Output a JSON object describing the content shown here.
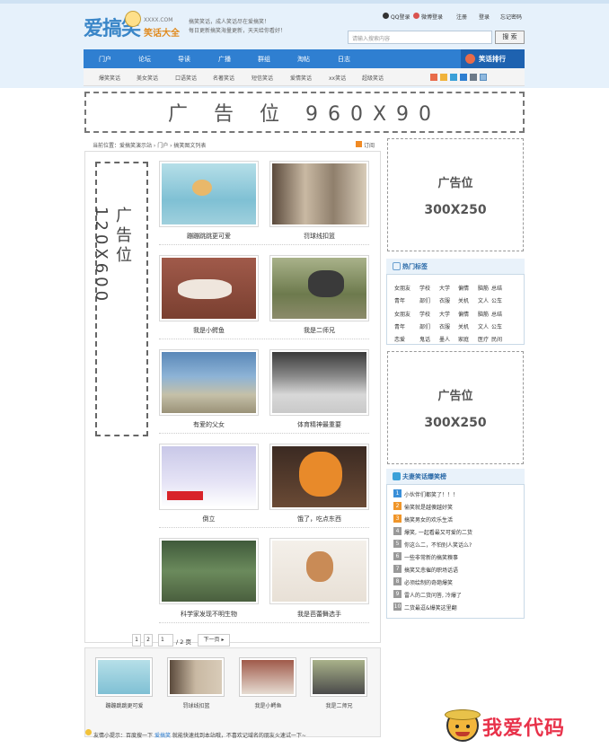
{
  "header": {
    "logo_main": "爱搞笑",
    "logo_domain": "XXXX.COM",
    "logo_sub": "笑话大全",
    "tagline1": "搞笑笑话，成人笑话尽在爱搞笑！",
    "tagline2": "每日更新搞笑海量更新，天天给你看好！",
    "links": [
      "QQ登录",
      "微博登录",
      "注册",
      "登录",
      "忘记密码"
    ],
    "search_placeholder": "请输入搜索内容",
    "search_button": "搜 索"
  },
  "nav": {
    "items": [
      "门户",
      "论坛",
      "导读",
      "广播",
      "群组",
      "淘帖",
      "日志"
    ],
    "rank_tab": "笑话排行"
  },
  "subnav": {
    "items": [
      "爆笑笑话",
      "美女笑话",
      "口语笑话",
      "名著笑话",
      "短信笑话",
      "爱情笑话",
      "xx笑话",
      "超级笑话"
    ]
  },
  "ad_banner": "广 告 位  960X90",
  "breadcrumb": "当前位置：爱搞笑演示站 › 门户 › 搞笑图文列表",
  "rss_label": "订阅",
  "ad_vertical": "广告位 120X600",
  "posts": [
    {
      "caption": "蹦蹦跳跳更可爱"
    },
    {
      "caption": "罚球线扣篮"
    },
    {
      "caption": "我是小鳄鱼"
    },
    {
      "caption": "我是二师兄"
    },
    {
      "caption": "有爱的父女"
    },
    {
      "caption": "体育精神最重要"
    },
    {
      "caption": "倒立"
    },
    {
      "caption": "饿了，吃点东西"
    },
    {
      "caption": "科学家发现不明生物"
    },
    {
      "caption": "我是芭蕾舞选手"
    }
  ],
  "pager": {
    "page1": "1",
    "page2": "2",
    "current": "1",
    "total": "/ 2 页",
    "next": "下一页"
  },
  "bottom_strip": [
    {
      "caption": "蹦蹦跳跳更可爱"
    },
    {
      "caption": "罚球线扣篮"
    },
    {
      "caption": "我是小鳄鱼"
    },
    {
      "caption": "我是二师兄"
    }
  ],
  "tip": {
    "prefix": "友情小提示：百度搜一下",
    "link": "爱搞笑",
    "suffix": "就能快速找到本站哦，不喜欢记域名的朋友火速试一下~"
  },
  "sidebar": {
    "ad1_line1": "广告位",
    "ad1_line2": "300X250",
    "hot_tags_title": "热门标签",
    "hot_tags": [
      [
        "女朋友",
        "学校",
        "大学",
        "偏情",
        "脑筋",
        "总结"
      ],
      [
        "青年",
        "部们",
        "衣服",
        "关机",
        "文人",
        "公车"
      ],
      [
        "女朋友",
        "学校",
        "大学",
        "偏情",
        "脑筋",
        "总结"
      ],
      [
        "青年",
        "部们",
        "衣服",
        "关机",
        "文人",
        "公车"
      ],
      [
        "恋爱",
        "鬼话",
        "墨人",
        "家庭",
        "医疗",
        "民间"
      ]
    ],
    "ad2_line1": "广告位",
    "ad2_line2": "300X250",
    "rank_title": "夫妻笑话爆笑榜",
    "rank_items": [
      "小伙伴们都笑了！！！",
      "偷笑就是越傻越好笑",
      "搞笑男女的欢乐生活",
      "爆笑, 一起看最又可爱的二货",
      "你这么二，不怕别人笑话么?",
      "一些非常新的搞笑糗事",
      "搞笑又悲催的职场话语",
      "必须绘制的奇葩爆笑",
      "雷人的二货问答, 冷爆了",
      "二货最逗&爆笑这里翻"
    ]
  },
  "watermark": "我爱代码",
  "colors": {
    "nav_blue": "#2f7fd1",
    "rank_blue": "#1e62b0",
    "header_bg": "#e6f1fb",
    "rank_top": "#3a8fd8",
    "rank_mid": "#f0962a",
    "watermark_red": "#e8324a"
  }
}
